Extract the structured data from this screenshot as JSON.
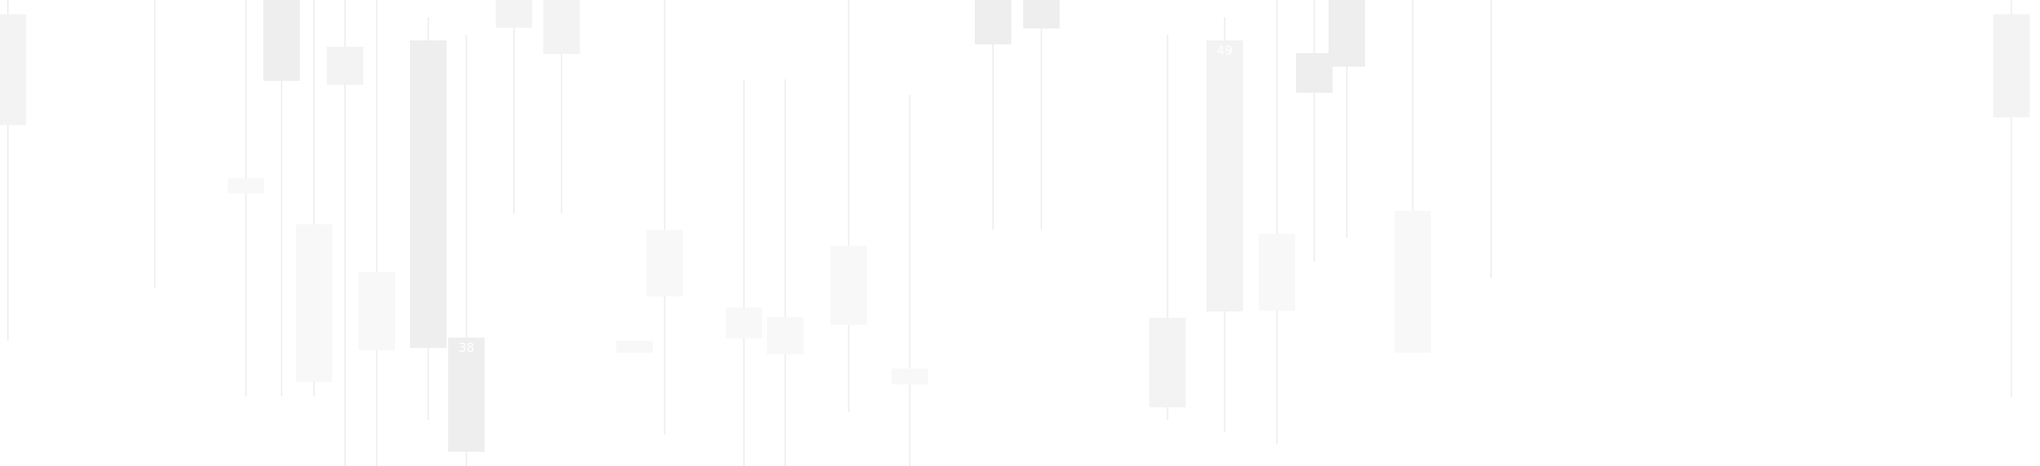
{
  "chart_data": {
    "type": "candlestick",
    "colors": {
      "background": "#ffffff",
      "wick": "#e0e0e0",
      "body_dark": "#eeeeee",
      "body_mid": "#f3f3f3",
      "body_light": "#f8f8f8",
      "label": "#ffffff"
    },
    "ylim": [
      0,
      588
    ],
    "candles": [
      {
        "low": 0,
        "high": 430,
        "top": 18,
        "bottom": 158,
        "shade": "body_mid"
      },
      {
        "low": 0,
        "high": 363,
        "top": null,
        "bottom": null,
        "shade": null
      },
      {
        "low": 0,
        "high": 500,
        "top": 225,
        "bottom": 244,
        "shade": "body_light"
      },
      {
        "low": 0,
        "high": 500,
        "top": 0,
        "bottom": 102,
        "shade": "body_dark"
      },
      {
        "low": 0,
        "high": 500,
        "top": 283,
        "bottom": 482,
        "shade": "body_light"
      },
      {
        "low": 0,
        "high": 588,
        "top": 59,
        "bottom": 107,
        "shade": "body_mid"
      },
      {
        "low": 0,
        "high": 588,
        "top": 343,
        "bottom": 442,
        "shade": "body_light"
      },
      {
        "low": 22,
        "high": 530,
        "top": 51,
        "bottom": 439,
        "shade": "body_dark"
      },
      {
        "low": 44,
        "high": 588,
        "top": 426,
        "bottom": 570,
        "shade": "body_dark",
        "label": "38"
      },
      {
        "low": 0,
        "high": 270,
        "top": 0,
        "bottom": 35,
        "shade": "body_mid"
      },
      {
        "low": 0,
        "high": 270,
        "top": 0,
        "bottom": 68,
        "shade": "body_mid"
      },
      {
        "low": 430,
        "high": 445,
        "top": 430,
        "bottom": 445,
        "shade": "body_light"
      },
      {
        "low": 0,
        "high": 548,
        "top": 290,
        "bottom": 374,
        "shade": "body_light"
      },
      {
        "low": 100,
        "high": 588,
        "top": 388,
        "bottom": 427,
        "shade": "body_light"
      },
      {
        "low": 100,
        "high": 588,
        "top": 400,
        "bottom": 447,
        "shade": "body_light"
      },
      {
        "low": 0,
        "high": 520,
        "top": 310,
        "bottom": 410,
        "shade": "body_light"
      },
      {
        "low": 120,
        "high": 588,
        "top": 465,
        "bottom": 485,
        "shade": "body_light"
      },
      {
        "low": 0,
        "high": 290,
        "top": 0,
        "bottom": 56,
        "shade": "body_dark"
      },
      {
        "low": 0,
        "high": 290,
        "top": 0,
        "bottom": 36,
        "shade": "body_dark"
      },
      {
        "low": 44,
        "high": 530,
        "top": 401,
        "bottom": 514,
        "shade": "body_mid"
      },
      {
        "low": 22,
        "high": 545,
        "top": 51,
        "bottom": 393,
        "shade": "body_mid",
        "label": "49"
      },
      {
        "low": 0,
        "high": 560,
        "top": 295,
        "bottom": 392,
        "shade": "body_light"
      },
      {
        "low": 0,
        "high": 330,
        "top": 67,
        "bottom": 117,
        "shade": "body_dark"
      },
      {
        "low": 0,
        "high": 300,
        "top": 0,
        "bottom": 84,
        "shade": "body_dark"
      },
      {
        "low": 0,
        "high": 420,
        "top": 266,
        "bottom": 445,
        "shade": "body_light"
      },
      {
        "low": 0,
        "high": 351,
        "top": null,
        "bottom": null,
        "shade": null
      },
      {
        "low": 0,
        "high": 501,
        "top": 18,
        "bottom": 148,
        "shade": "body_mid"
      }
    ]
  }
}
